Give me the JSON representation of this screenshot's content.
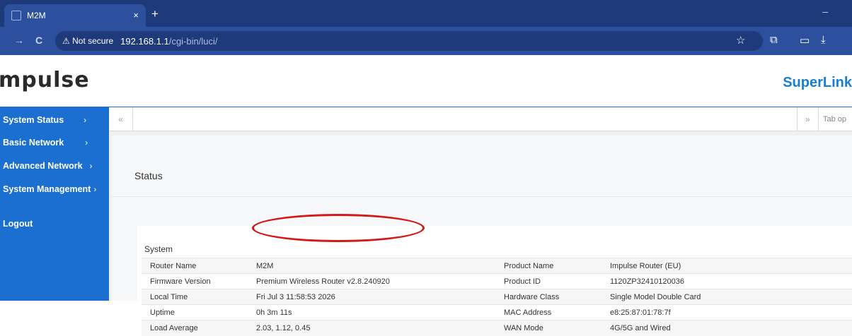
{
  "browser": {
    "tab_title": "M2M",
    "tab_close": "×",
    "new_tab": "+",
    "window_controls": "–",
    "not_secure_label": "Not secure",
    "url_host": "192.168.1.1",
    "url_path": "/cgi-bin/luci/",
    "forward_icon": "→",
    "reload_icon": "C",
    "warning_icon": "⚠"
  },
  "header": {
    "logo_text": "mpulse",
    "brand": "SuperLink"
  },
  "sidebar": {
    "items": [
      {
        "label": "System Status",
        "chevron": "›"
      },
      {
        "label": "Basic Network",
        "chevron": "›"
      },
      {
        "label": "Advanced Network",
        "chevron": "›"
      },
      {
        "label": "System Management",
        "chevron": "›"
      },
      {
        "label": "Logout",
        "chevron": ""
      }
    ]
  },
  "tabstrip": {
    "left_arrow": "«",
    "right_arrow": "»",
    "options_label": "Tab op"
  },
  "main": {
    "title": "Status",
    "section_title": "System"
  },
  "system_table": {
    "rows": [
      [
        "Router Name",
        "M2M",
        "Product Name",
        "Impulse Router (EU)"
      ],
      [
        "Firmware Version",
        "Premium Wireless Router v2.8.240920",
        "Product ID",
        "1120ZP32410120036"
      ],
      [
        "Local Time",
        "Fri Jul 3 11:58:53 2026",
        "Hardware Class",
        "Single Model Double Card"
      ],
      [
        "Uptime",
        "0h 3m 11s",
        "MAC Address",
        "e8:25:87:01:78:7f"
      ],
      [
        "Load Average",
        "2.03, 1.12, 0.45",
        "WAN Mode",
        "4G/5G and Wired"
      ]
    ]
  },
  "colors": {
    "sidebar": "#1b6fd1",
    "brand": "#1b7fd1",
    "annotation": "#d11a1a"
  }
}
